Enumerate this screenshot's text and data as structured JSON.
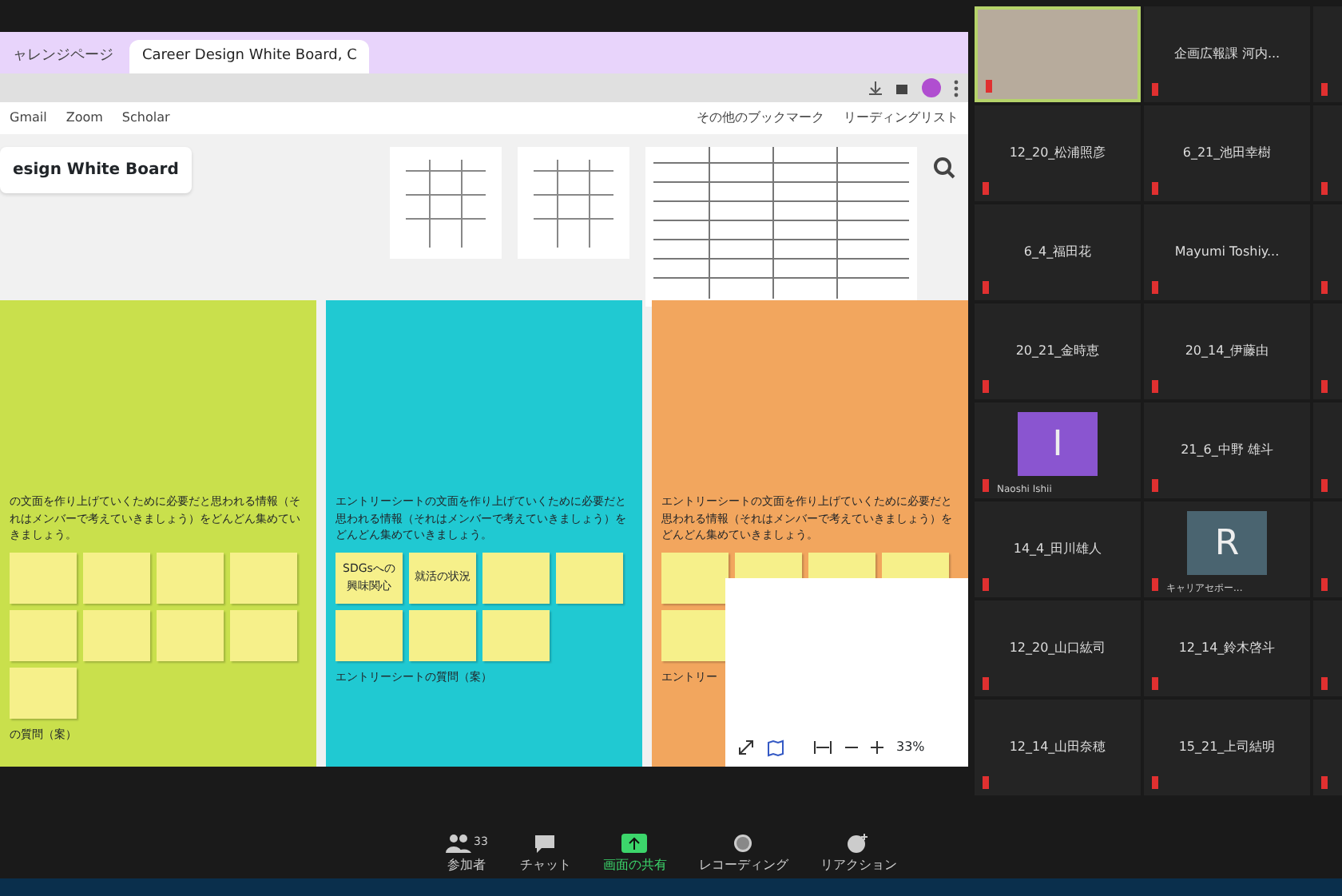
{
  "browser": {
    "tabs": [
      {
        "label": "ャレンジページ",
        "selected": false
      },
      {
        "label": "Career Design White Board, C",
        "selected": true
      }
    ],
    "bookmarks": [
      {
        "label": "Gmail"
      },
      {
        "label": "Zoom"
      },
      {
        "label": "Scholar"
      }
    ],
    "bookmark_extras": [
      "その他のブックマーク",
      "リーディングリスト"
    ]
  },
  "board": {
    "title": "esign White Board",
    "panels": [
      {
        "color": "#c9e04c",
        "heading": "の文面を作り上げていくために必要だと思われる情報（それはメンバーで考えていきましょう）をどんどん集めていきましょう。",
        "section": "の質問（案）"
      },
      {
        "color": "#20c9d2",
        "heading": "エントリーシートの文面を作り上げていくために必要だと思われる情報（それはメンバーで考えていきましょう）をどんどん集めていきましょう。",
        "notes": [
          "SDGsへの興味関心",
          "就活の状況"
        ],
        "section": "エントリーシートの質問（案）"
      },
      {
        "color": "#f2a65e",
        "heading": "エントリーシートの文面を作り上げていくために必要だと思われる情報（それはメンバーで考えていきましょう）をどんどん集めていきましょう。",
        "section": "エントリー"
      }
    ],
    "zoom_level": "33%"
  },
  "participants": [
    {
      "kind": "video",
      "selected": true
    },
    {
      "kind": "name",
      "name": "企画広報課 河内...",
      "selected": false
    },
    {
      "kind": "name",
      "name": "12_20_松浦照彦",
      "selected": false
    },
    {
      "kind": "name",
      "name": "6_21_池田幸樹",
      "selected": false
    },
    {
      "kind": "name",
      "name": "6_4_福田花",
      "selected": false
    },
    {
      "kind": "name",
      "name": "Mayumi Toshiy...",
      "selected": false
    },
    {
      "kind": "name",
      "name": "20_21_金時恵",
      "selected": false
    },
    {
      "kind": "name",
      "name": "20_14_伊藤由",
      "selected": false
    },
    {
      "kind": "avatar",
      "initial": "I",
      "caption": "Naoshi Ishii",
      "color": "#8a55d0",
      "selected": false
    },
    {
      "kind": "name",
      "name": "21_6_中野 雄斗",
      "selected": false
    },
    {
      "kind": "name",
      "name": "14_4_田川雄人",
      "selected": false
    },
    {
      "kind": "avatar",
      "initial": "R",
      "caption": "キャリアセポー...",
      "color": "#4a6470",
      "selected": false
    },
    {
      "kind": "name",
      "name": "12_20_山口紘司",
      "selected": false
    },
    {
      "kind": "name",
      "name": "12_14_鈴木啓斗",
      "selected": false
    },
    {
      "kind": "name",
      "name": "12_14_山田奈穂",
      "selected": false
    },
    {
      "kind": "name",
      "name": "15_21_上司結明",
      "selected": false
    }
  ],
  "toolbar": {
    "participant_count": "33",
    "items": [
      {
        "kind": "participants",
        "label": "参加者"
      },
      {
        "kind": "chat",
        "label": "チャット"
      },
      {
        "kind": "share",
        "label": "画面の共有"
      },
      {
        "kind": "record",
        "label": "レコーディング"
      },
      {
        "kind": "reactions",
        "label": "リアクション"
      }
    ]
  }
}
